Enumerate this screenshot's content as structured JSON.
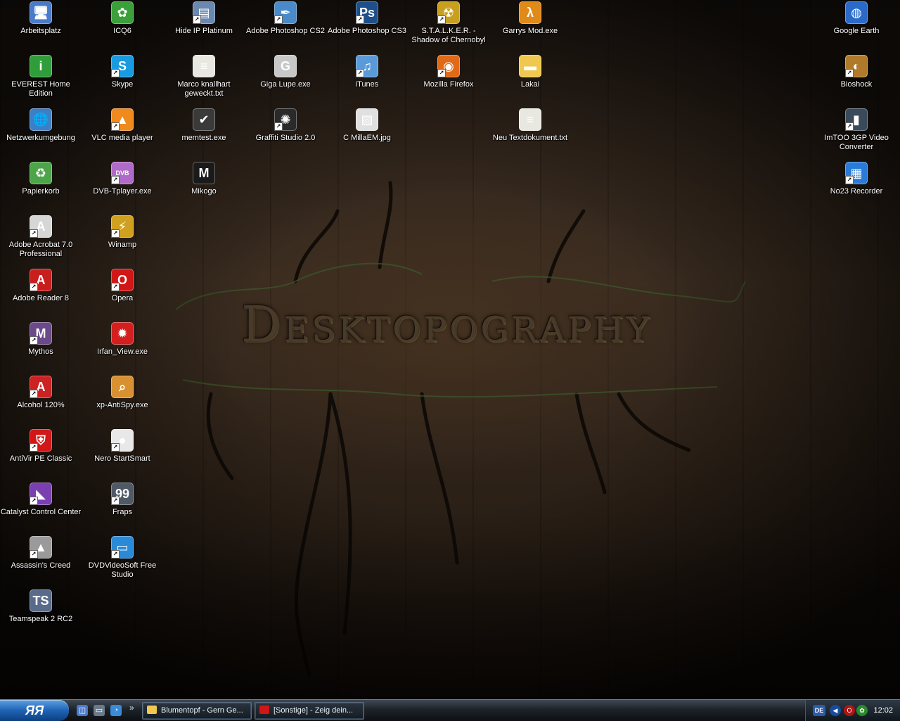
{
  "wallpaper": {
    "title": "Desktopography"
  },
  "desktop_icons": [
    {
      "label": "Arbeitsplatz",
      "icon": "computer-icon",
      "glyph": "🖥",
      "color": "#4a7bc8",
      "shortcut": false
    },
    {
      "label": "EVEREST Home Edition",
      "icon": "everest-icon",
      "glyph": "i",
      "color": "#2f9e3a",
      "shortcut": false
    },
    {
      "label": "Netzwerkumgebung",
      "icon": "network-icon",
      "glyph": "🌐",
      "color": "#3d7fc4",
      "shortcut": false
    },
    {
      "label": "Papierkorb",
      "icon": "recycle-bin-icon",
      "glyph": "♻",
      "color": "#4da54a",
      "shortcut": false
    },
    {
      "label": "Adobe Acrobat 7.0 Professional",
      "icon": "acrobat-icon",
      "glyph": "A",
      "color": "#d6d6d6",
      "shortcut": true
    },
    {
      "label": "Adobe Reader 8",
      "icon": "adobe-reader-icon",
      "glyph": "A",
      "color": "#c81e1e",
      "shortcut": true
    },
    {
      "label": "Mythos",
      "icon": "mythos-icon",
      "glyph": "M",
      "color": "#6b4a8a",
      "shortcut": true
    },
    {
      "label": "Alcohol 120%",
      "icon": "alcohol-icon",
      "glyph": "A",
      "color": "#cc2222",
      "shortcut": true
    },
    {
      "label": "AntiVir PE Classic",
      "icon": "antivir-icon",
      "glyph": "⛨",
      "color": "#d01818",
      "shortcut": true
    },
    {
      "label": "Catalyst Control Center",
      "icon": "catalyst-icon",
      "glyph": "◣",
      "color": "#7a3fb0",
      "shortcut": true
    },
    {
      "label": "Assassin's Creed",
      "icon": "assassins-creed-icon",
      "glyph": "▲",
      "color": "#9a9a9a",
      "shortcut": true
    },
    {
      "label": "Teamspeak 2 RC2",
      "icon": "teamspeak-icon",
      "glyph": "TS",
      "color": "#5a6a8a",
      "shortcut": false
    },
    {
      "label": "ICQ6",
      "icon": "icq-icon",
      "glyph": "✿",
      "color": "#3aa03a",
      "shortcut": false
    },
    {
      "label": "Skype",
      "icon": "skype-icon",
      "glyph": "S",
      "color": "#1a9be0",
      "shortcut": true
    },
    {
      "label": "VLC media player",
      "icon": "vlc-icon",
      "glyph": "▲",
      "color": "#f08a1c",
      "shortcut": true
    },
    {
      "label": "DVB-Tplayer.exe",
      "icon": "dvb-player-icon",
      "glyph": "DVB",
      "color": "#b06ac8",
      "shortcut": true
    },
    {
      "label": "Winamp",
      "icon": "winamp-icon",
      "glyph": "⚡",
      "color": "#d0a020",
      "shortcut": true
    },
    {
      "label": "Opera",
      "icon": "opera-icon",
      "glyph": "O",
      "color": "#d01616",
      "shortcut": true
    },
    {
      "label": "Irfan_View.exe",
      "icon": "irfanview-icon",
      "glyph": "✹",
      "color": "#d41f1f",
      "shortcut": false
    },
    {
      "label": "xp-AntiSpy.exe",
      "icon": "xp-antispy-icon",
      "glyph": "⌕",
      "color": "#d89030",
      "shortcut": false
    },
    {
      "label": "Nero StartSmart",
      "icon": "nero-icon",
      "glyph": "●",
      "color": "#e8e8e8",
      "shortcut": true
    },
    {
      "label": "Fraps",
      "icon": "fraps-icon",
      "glyph": "99",
      "color": "#505a66",
      "shortcut": true
    },
    {
      "label": "DVDVideoSoft Free Studio",
      "icon": "dvdvideosoft-icon",
      "glyph": "▭",
      "color": "#2a8ad8",
      "shortcut": true
    },
    {
      "label": "Hide IP Platinum",
      "icon": "hide-ip-icon",
      "glyph": "▤",
      "color": "#6a88b0",
      "shortcut": true
    },
    {
      "label": "Marco knallhart geweckt.txt",
      "icon": "text-file-icon",
      "glyph": "≡",
      "color": "#e8e8e0",
      "shortcut": false
    },
    {
      "label": "memtest.exe",
      "icon": "memtest-icon",
      "glyph": "✔",
      "color": "#3a3a3a",
      "shortcut": false
    },
    {
      "label": "Mikogo",
      "icon": "mikogo-icon",
      "glyph": "M",
      "color": "#1a1a1a",
      "shortcut": false
    },
    {
      "label": "Adobe Photoshop CS2",
      "icon": "photoshop-cs2-icon",
      "glyph": "✒",
      "color": "#4a8ac8",
      "shortcut": true
    },
    {
      "label": "Giga Lupe.exe",
      "icon": "giga-lupe-icon",
      "glyph": "G",
      "color": "#c8c8c8",
      "shortcut": false
    },
    {
      "label": "Graffiti Studio 2.0",
      "icon": "graffiti-studio-icon",
      "glyph": "✺",
      "color": "#2a2a2a",
      "shortcut": true
    },
    {
      "label": "Adobe Photoshop CS3",
      "icon": "photoshop-cs3-icon",
      "glyph": "Ps",
      "color": "#1e4f8a",
      "shortcut": true
    },
    {
      "label": "iTunes",
      "icon": "itunes-icon",
      "glyph": "♫",
      "color": "#5a9ad8",
      "shortcut": true
    },
    {
      "label": "C MillaEM.jpg",
      "icon": "image-file-icon",
      "glyph": "▧",
      "color": "#e0e0e0",
      "shortcut": false
    },
    {
      "label": "S.T.A.L.K.E.R. - Shadow of Chernobyl",
      "icon": "stalker-icon",
      "glyph": "☢",
      "color": "#c8a020",
      "shortcut": true
    },
    {
      "label": "Mozilla Firefox",
      "icon": "firefox-icon",
      "glyph": "◉",
      "color": "#e06a18",
      "shortcut": true
    },
    {
      "label": "Garrys Mod.exe",
      "icon": "garrys-mod-icon",
      "glyph": "λ",
      "color": "#e08a1a",
      "shortcut": false
    },
    {
      "label": "Lakai",
      "icon": "folder-icon",
      "glyph": "▬",
      "color": "#f0c850",
      "shortcut": false
    },
    {
      "label": "Neu Textdokument.txt",
      "icon": "text-file-icon",
      "glyph": "≡",
      "color": "#e8e8e0",
      "shortcut": false
    },
    {
      "label": "Google Earth",
      "icon": "google-earth-icon",
      "glyph": "◍",
      "color": "#2a6ac8",
      "shortcut": false
    },
    {
      "label": "Bioshock",
      "icon": "bioshock-icon",
      "glyph": "◐",
      "color": "#b07a2a",
      "shortcut": true
    },
    {
      "label": "ImTOO 3GP Video Converter",
      "icon": "imtoo-icon",
      "glyph": "▮",
      "color": "#3a4a5a",
      "shortcut": true
    },
    {
      "label": "No23 Recorder",
      "icon": "no23-recorder-icon",
      "glyph": "▦",
      "color": "#2a7ad8",
      "shortcut": true
    }
  ],
  "taskbar": {
    "start_label": "ЯЯ",
    "quick_launch": [
      {
        "icon": "show-desktop-icon",
        "glyph": "◫",
        "color": "#4a7ac8"
      },
      {
        "icon": "window-icon",
        "glyph": "▭",
        "color": "#6a7a8a"
      },
      {
        "icon": "media-icon",
        "glyph": "◔",
        "color": "#3a8ad8"
      }
    ],
    "overflow_label": "»",
    "tasks": [
      {
        "label": "Blumentopf - Gern Ge...",
        "icon": "folder-icon",
        "color": "#f0c850"
      },
      {
        "label": "[Sonstige] - Zeig dein...",
        "icon": "opera-icon",
        "color": "#d01616"
      }
    ],
    "tray": {
      "language": "DE",
      "clock": "12:02"
    }
  }
}
